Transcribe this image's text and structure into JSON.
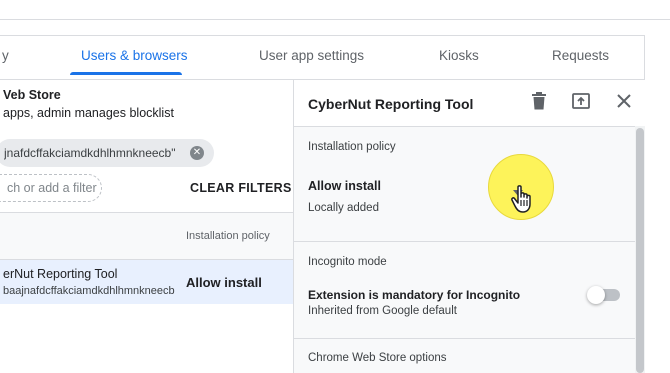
{
  "tabs": [
    {
      "label": "y",
      "active": false
    },
    {
      "label": "Users & browsers",
      "active": true
    },
    {
      "label": "User app settings",
      "active": false
    },
    {
      "label": "Kiosks",
      "active": false
    },
    {
      "label": "Requests",
      "active": false
    }
  ],
  "left": {
    "title": "Veb Store",
    "subtitle": "apps, admin manages blocklist",
    "filter_chip": "jnafdcffakciamdkdhlhmnkneecb\"",
    "filter_placeholder": "ch or add a filter",
    "clear_filters": "CLEAR FILTERS",
    "column_header": "Installation policy",
    "row": {
      "name": "erNut Reporting Tool",
      "id": "baajnafdcffakciamdkdhlhmnkneecb",
      "policy": "Allow install"
    }
  },
  "panel": {
    "title": "CyberNut Reporting Tool",
    "installation": {
      "label": "Installation policy",
      "value": "Allow install",
      "source": "Locally added"
    },
    "incognito": {
      "label": "Incognito mode",
      "value": "Extension is mandatory for Incognito",
      "source": "Inherited from Google default",
      "enabled": false
    },
    "webstore_label": "Chrome Web Store options"
  },
  "icons": [
    "delete-icon",
    "publish-icon",
    "close-icon",
    "dropdown-arrow-icon",
    "hand-pointer-icon"
  ],
  "colors": {
    "accent": "#1a73e8",
    "selected_row": "#e8f0fe",
    "cursor_highlight": "#fdf35a"
  }
}
